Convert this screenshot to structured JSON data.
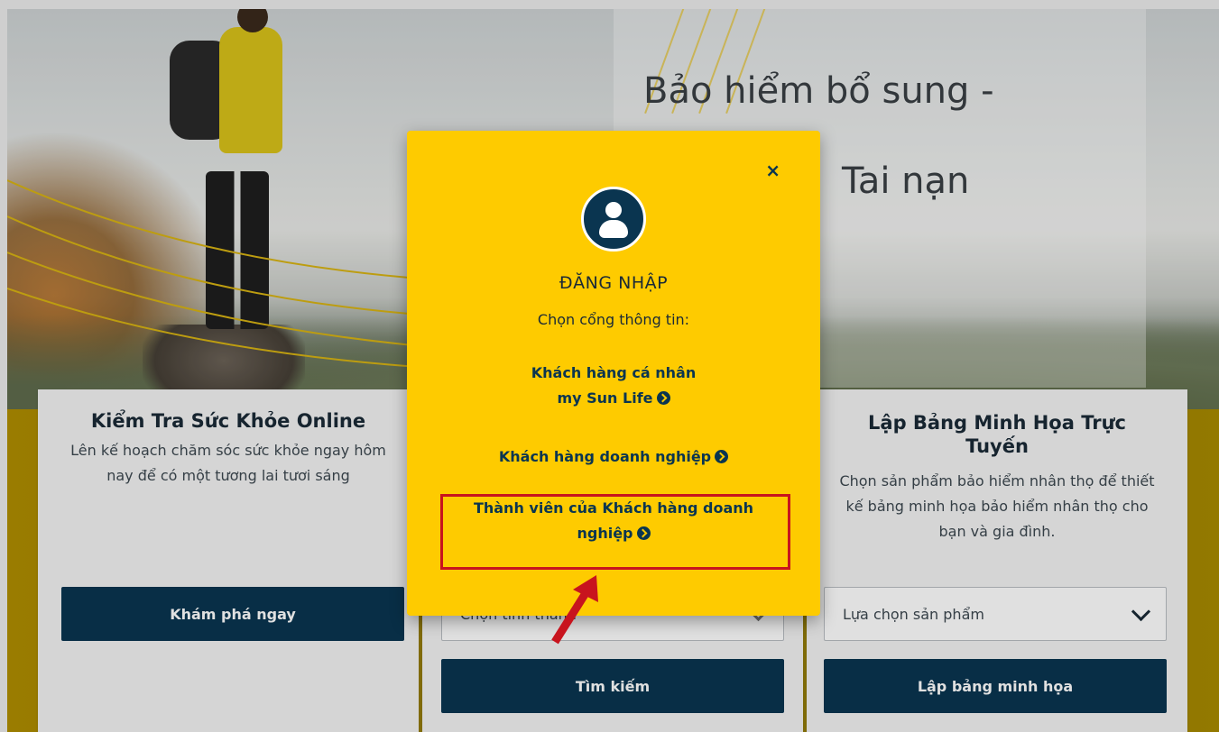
{
  "hero": {
    "title_line1": "Bảo hiểm bổ sung -",
    "title_line2": "Tai nạn"
  },
  "cards": {
    "left": {
      "title": "Kiểm Tra Sức Khỏe Online",
      "description": "Lên kế hoạch chăm sóc sức khỏe ngay hôm nay để có một tương lai tươi sáng",
      "button": "Khám phá ngay"
    },
    "middle": {
      "select_placeholder": "Chọn tỉnh thành",
      "button": "Tìm kiếm"
    },
    "right": {
      "title": "Lập Bảng Minh Họa Trực Tuyến",
      "description": "Chọn sản phẩm bảo hiểm nhân thọ để thiết kế bảng minh họa bảo hiểm nhân thọ cho bạn và gia đình.",
      "select_value": "Lựa chọn sản phẩm",
      "button": "Lập bảng minh họa"
    }
  },
  "modal": {
    "close": "×",
    "title": "ĐĂNG NHẬP",
    "subtitle": "Chọn cổng thông tin:",
    "links": [
      {
        "line1": "Khách hàng cá nhân",
        "line2": "my Sun Life"
      },
      {
        "line1": "Khách hàng doanh nghiệp"
      },
      {
        "line1": "Thành viên của Khách hàng doanh",
        "line2": "nghiệp"
      }
    ]
  },
  "colors": {
    "modal_bg": "#fecb00",
    "navy": "#0a3550",
    "highlight": "#c8141e"
  },
  "icons": {
    "avatar": "user-icon",
    "link_arrow": "chevron-circle-right-icon",
    "close": "close-icon"
  }
}
